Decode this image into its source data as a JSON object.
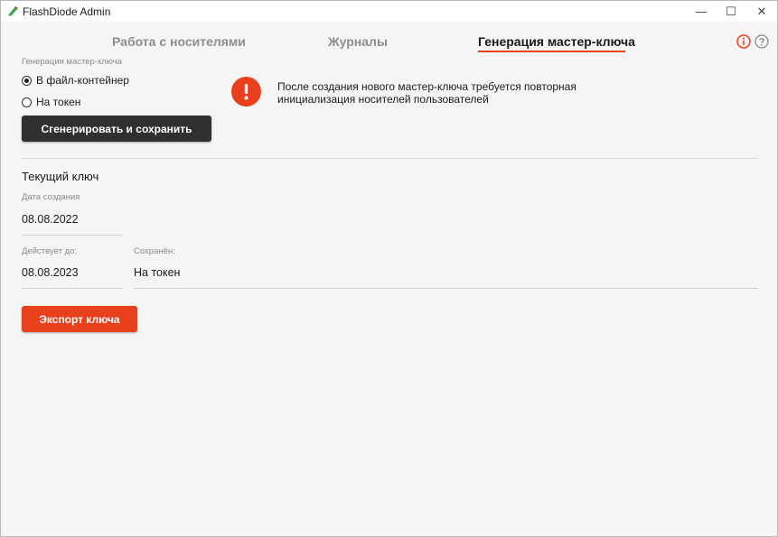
{
  "window": {
    "title": "FlashDiode Admin",
    "controls": {
      "minimize": "—",
      "maximize": "☐",
      "close": "✕"
    }
  },
  "tabs": [
    {
      "label": "Работа с носителями",
      "active": false
    },
    {
      "label": "Журналы",
      "active": false
    },
    {
      "label": "Генерация мастер-ключа",
      "active": true
    }
  ],
  "header_icons": [
    "info-icon",
    "help-icon"
  ],
  "generation": {
    "caption": "Генерация мастер-ключа",
    "options": [
      {
        "label": "В файл-контейнер",
        "selected": true
      },
      {
        "label": "На токен",
        "selected": false
      }
    ],
    "generate_button": "Сгенерировать и сохранить"
  },
  "warning": {
    "icon": "exclamation-icon",
    "text": "После создания нового мастер-ключа требуется повторная инициализация носителей пользователей"
  },
  "current_key": {
    "title": "Текущий ключ",
    "created_label": "Дата создания",
    "created_value": "08.08.2022",
    "valid_label": "Действует до:",
    "valid_value": "08.08.2023",
    "saved_label": "Сохранён:",
    "saved_value": "На токен",
    "export_button": "Экспорт ключа"
  },
  "colors": {
    "accent": "#e8401c",
    "dark_button": "#303030",
    "background": "#f5f5f5",
    "muted_text": "#8a8a8a"
  }
}
